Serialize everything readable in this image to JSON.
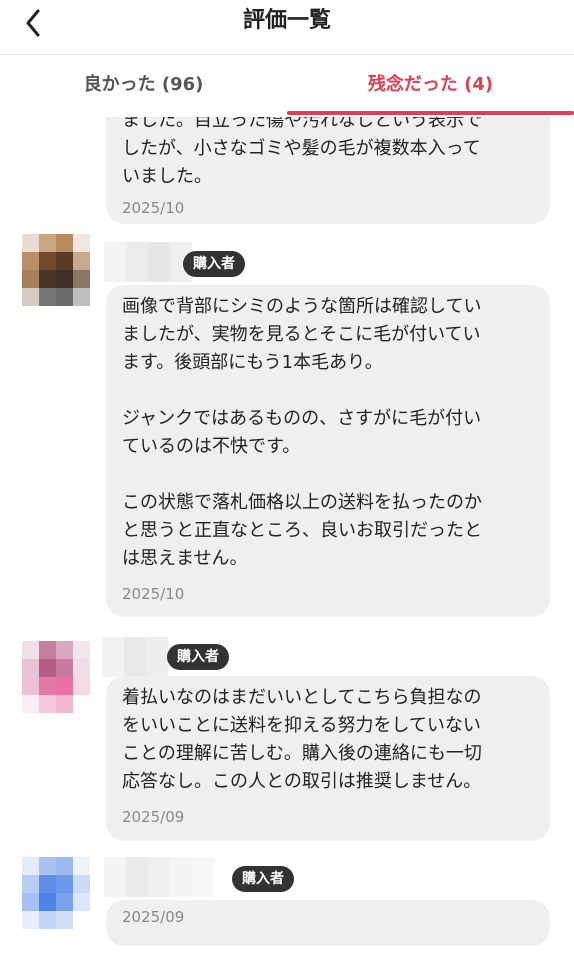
{
  "header": {
    "title": "評価一覧",
    "back_icon": "chevron-left-icon"
  },
  "tabs": [
    {
      "label": "良かった (96)",
      "active": false
    },
    {
      "label": "残念だった (4)",
      "active": true
    }
  ],
  "colors": {
    "accent": "#e03e52",
    "bubble": "#efefef",
    "badge": "#333333"
  },
  "reviews": [
    {
      "text": "ました。目立った傷や汚れなしという表示で\nしたが、小さなゴミや髪の毛が複数本入って\nいました。",
      "date": "2025/10"
    },
    {
      "badge": "購入者",
      "text": "画像で背部にシミのような箇所は確認してい\nましたが、実物を見るとそこに毛が付いてい\nます。後頭部にもう1本毛あり。\n\nジャンクではあるものの、さすがに毛が付い\nているのは不快です。\n\nこの状態で落札価格以上の送料を払ったのか\nと思うと正直なところ、良いお取引だったと\nは思えません。",
      "date": "2025/10"
    },
    {
      "badge": "購入者",
      "text": "着払いなのはまだいいとしてこちら負担なの\nをいいことに送料を抑える努力をしていない\nことの理解に苦しむ。購入後の連絡にも一切\n応答なし。この人との取引は推奨しません。",
      "date": "2025/09"
    },
    {
      "badge": "購入者",
      "text": "",
      "date": "2025/09"
    }
  ]
}
